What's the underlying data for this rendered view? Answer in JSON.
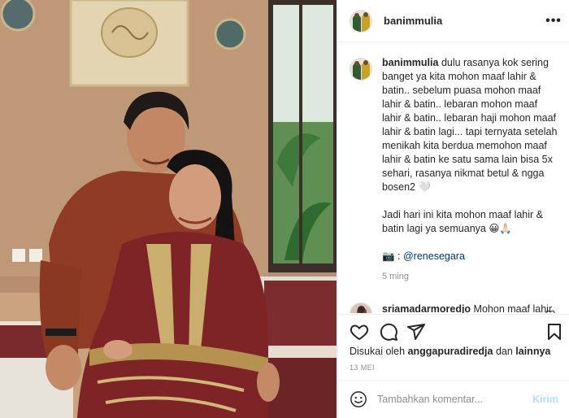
{
  "post": {
    "username": "banimmulia",
    "more_label": "•••"
  },
  "caption": {
    "username": "banimmulia",
    "text": " dulu rasanya kok sering banget ya kita mohon maaf lahir & batin.. sebelum puasa mohon maaf lahir & batin.. lebaran mohon maaf lahir & batin.. lebaran haji mohon maaf lahir & batin lagi... tapi ternyata setelah menikah kita berdua memohon maaf lahir & batin ke satu sama lain bisa 5x sehari, rasanya nikmat betul & ngga bosen2 🤍\n\nJadi hari ini kita mohon maaf lahir & batin lagi ya semuanya 😀🙏🏻",
    "credit_prefix": "📷 : ",
    "mention": "@renesegara",
    "time": "5 ming"
  },
  "comment": {
    "username": "sriamadarmoredjo",
    "text": " Mohon maaf lahir bathin ya mbak Lulu dan"
  },
  "likes": {
    "prefix": "Disukai oleh ",
    "user": "anggapuradiredja",
    "middle": " dan ",
    "others": "lainnya"
  },
  "date": "13 MEI",
  "add_comment": {
    "placeholder": "Tambahkan komentar...",
    "post_label": "Kirim"
  },
  "icons": {
    "like": "heart-icon",
    "comment": "comment-icon",
    "share": "paper-plane-icon",
    "save": "bookmark-icon",
    "emoji": "smiley-icon",
    "more": "ellipsis-icon"
  },
  "colors": {
    "text": "#262626",
    "muted": "#8e8e8e",
    "mention": "#00376b",
    "post_disabled": "#b2dffc",
    "border": "#efefef"
  }
}
